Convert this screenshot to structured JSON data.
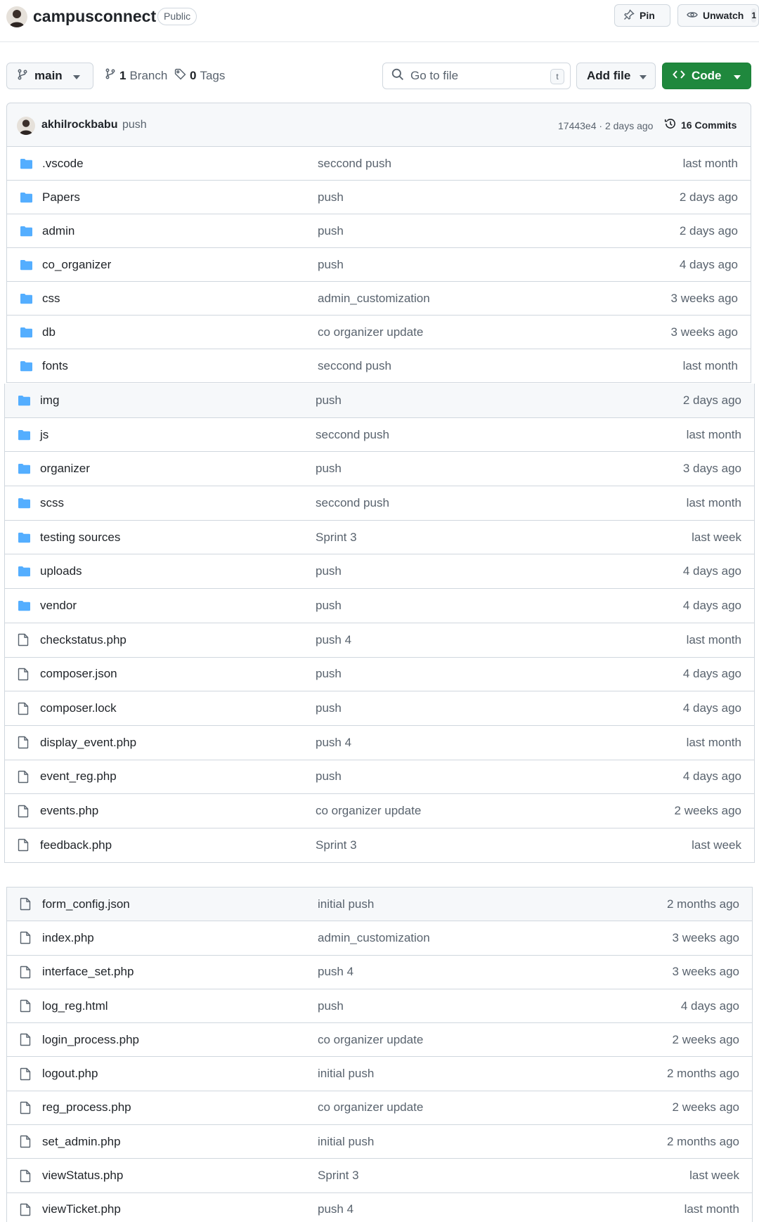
{
  "header": {
    "repo_name": "campusconnect",
    "visibility": "Public",
    "pin_label": "Pin",
    "watch_label": "Unwatch",
    "watch_count": "1"
  },
  "toolbar": {
    "branch_name": "main",
    "branch_count": "1",
    "branch_word": "Branch",
    "tag_count": "0",
    "tag_word": "Tags",
    "search_placeholder": "Go to file",
    "search_shortcut": "t",
    "add_file_label": "Add file",
    "code_label": "Code"
  },
  "latest_commit": {
    "author": "akhilrockbabu",
    "message": "push",
    "meta": "17443e4 · 2 days ago",
    "commits_label": "16 Commits"
  },
  "colors": {
    "folder": "#54aeff",
    "code_button": "#1f883d",
    "muted_text": "#59636e"
  },
  "section1": [
    {
      "type": "folder",
      "name": ".vscode",
      "message": "seccond push",
      "age": "last month"
    },
    {
      "type": "folder",
      "name": "Papers",
      "message": "push",
      "age": "2 days ago"
    },
    {
      "type": "folder",
      "name": "admin",
      "message": "push",
      "age": "2 days ago"
    },
    {
      "type": "folder",
      "name": "co_organizer",
      "message": "push",
      "age": "4 days ago"
    },
    {
      "type": "folder",
      "name": "css",
      "message": "admin_customization",
      "age": "3 weeks ago"
    },
    {
      "type": "folder",
      "name": "db",
      "message": "co organizer update",
      "age": "3 weeks ago"
    },
    {
      "type": "folder",
      "name": "fonts",
      "message": "seccond push",
      "age": "last month"
    }
  ],
  "section2": [
    {
      "type": "folder",
      "name": "img",
      "message": "push",
      "age": "2 days ago",
      "highlight": true
    },
    {
      "type": "folder",
      "name": "js",
      "message": "seccond push",
      "age": "last month"
    },
    {
      "type": "folder",
      "name": "organizer",
      "message": "push",
      "age": "3 days ago"
    },
    {
      "type": "folder",
      "name": "scss",
      "message": "seccond push",
      "age": "last month"
    },
    {
      "type": "folder",
      "name": "testing sources",
      "message": "Sprint 3",
      "age": "last week"
    },
    {
      "type": "folder",
      "name": "uploads",
      "message": "push",
      "age": "4 days ago"
    },
    {
      "type": "folder",
      "name": "vendor",
      "message": "push",
      "age": "4 days ago"
    },
    {
      "type": "file",
      "name": "checkstatus.php",
      "message": "push 4",
      "age": "last month"
    },
    {
      "type": "file",
      "name": "composer.json",
      "message": "push",
      "age": "4 days ago"
    },
    {
      "type": "file",
      "name": "composer.lock",
      "message": "push",
      "age": "4 days ago"
    },
    {
      "type": "file",
      "name": "display_event.php",
      "message": "push 4",
      "age": "last month"
    },
    {
      "type": "file",
      "name": "event_reg.php",
      "message": "push",
      "age": "4 days ago"
    },
    {
      "type": "file",
      "name": "events.php",
      "message": "co organizer update",
      "age": "2 weeks ago"
    },
    {
      "type": "file",
      "name": "feedback.php",
      "message": "Sprint 3",
      "age": "last week"
    }
  ],
  "section3": [
    {
      "type": "file",
      "name": "form_config.json",
      "message": "initial push",
      "age": "2 months ago",
      "highlight": true
    },
    {
      "type": "file",
      "name": "index.php",
      "message": "admin_customization",
      "age": "3 weeks ago"
    },
    {
      "type": "file",
      "name": "interface_set.php",
      "message": "push 4",
      "age": "3 weeks ago"
    },
    {
      "type": "file",
      "name": "log_reg.html",
      "message": "push",
      "age": "4 days ago"
    },
    {
      "type": "file",
      "name": "login_process.php",
      "message": "co organizer update",
      "age": "2 weeks ago"
    },
    {
      "type": "file",
      "name": "logout.php",
      "message": "initial push",
      "age": "2 months ago"
    },
    {
      "type": "file",
      "name": "reg_process.php",
      "message": "co organizer update",
      "age": "2 weeks ago"
    },
    {
      "type": "file",
      "name": "set_admin.php",
      "message": "initial push",
      "age": "2 months ago"
    },
    {
      "type": "file",
      "name": "viewStatus.php",
      "message": "Sprint 3",
      "age": "last week"
    },
    {
      "type": "file",
      "name": "viewTicket.php",
      "message": "push 4",
      "age": "last month"
    }
  ]
}
